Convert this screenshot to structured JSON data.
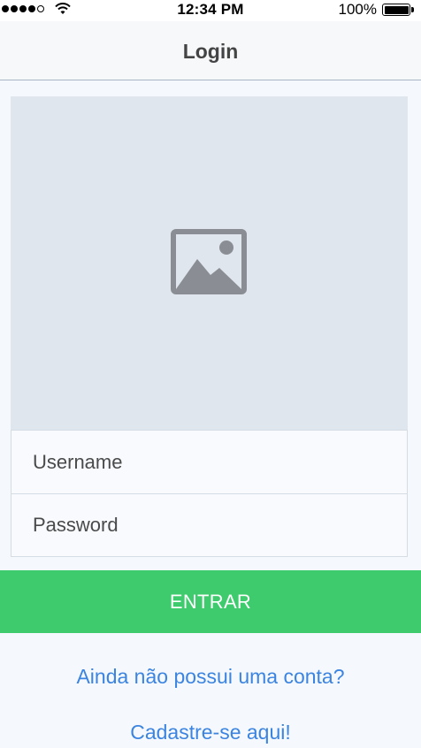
{
  "status_bar": {
    "time": "12:34 PM",
    "battery": "100%",
    "signal_bars_filled": 4,
    "signal_bars_total": 5
  },
  "nav": {
    "title": "Login"
  },
  "image_placeholder": {
    "icon": "image-icon"
  },
  "form": {
    "username_placeholder": "Username",
    "password_placeholder": "Password",
    "submit_label": "ENTRAR"
  },
  "links": {
    "no_account": "Ainda não possui uma conta?",
    "register": "Cadastre-se aqui!"
  },
  "colors": {
    "accent_green": "#3ecb6d",
    "link_blue": "#3b84e0",
    "placeholder_bg": "#e0e6ee",
    "icon_gray": "#8a8d93"
  }
}
